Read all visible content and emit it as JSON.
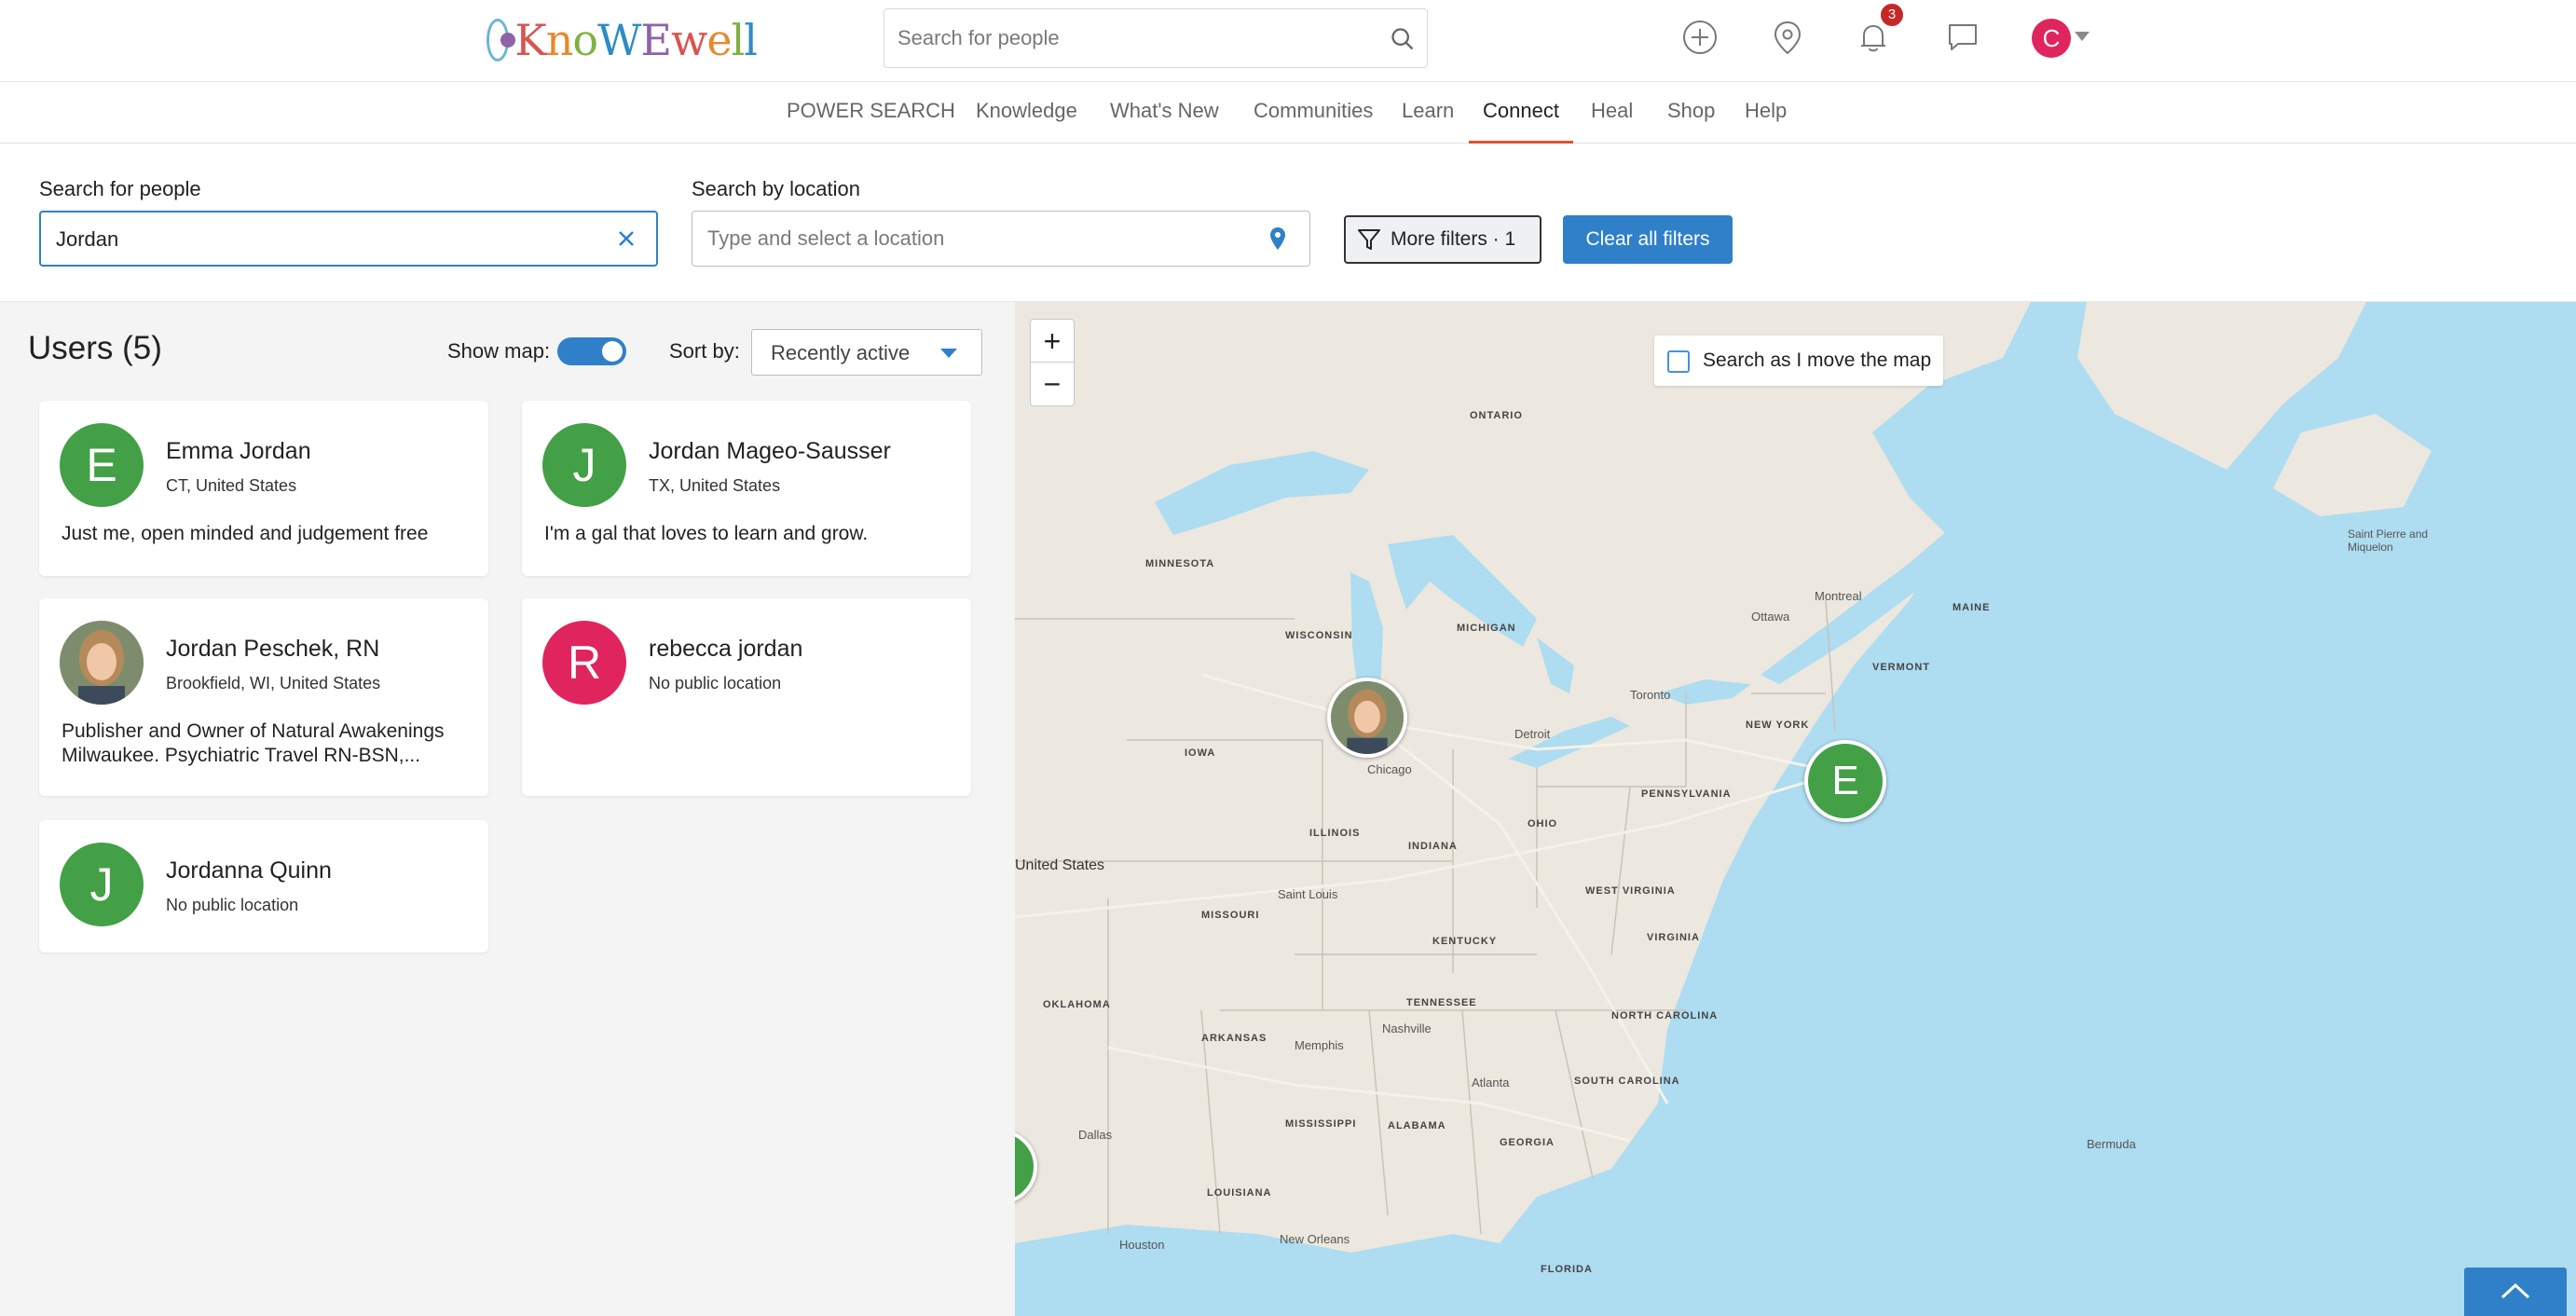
{
  "header": {
    "logo_text": "KnoWEwell",
    "search_placeholder": "Search for people",
    "notification_count": "3",
    "user_initial": "C"
  },
  "nav": {
    "items": [
      {
        "label": "POWER SEARCH"
      },
      {
        "label": "Knowledge"
      },
      {
        "label": "What's New"
      },
      {
        "label": "Communities"
      },
      {
        "label": "Learn"
      },
      {
        "label": "Connect",
        "active": true
      },
      {
        "label": "Heal"
      },
      {
        "label": "Shop"
      },
      {
        "label": "Help"
      }
    ]
  },
  "filters": {
    "people_label": "Search for people",
    "people_value": "Jordan",
    "location_label": "Search by location",
    "location_placeholder": "Type and select a location",
    "more_filters_label": "More filters · 1",
    "clear_label": "Clear all filters"
  },
  "results": {
    "title": "Users (5)",
    "show_map_label": "Show map:",
    "show_map_on": true,
    "sort_label": "Sort by:",
    "sort_value": "Recently active",
    "users": [
      {
        "initial": "E",
        "name": "Emma Jordan",
        "location": "CT, United States",
        "bio": "Just me, open minded and judgement free",
        "avatar_color": "#43a047"
      },
      {
        "initial": "J",
        "name": "Jordan Mageo-Sausser",
        "location": "TX, United States",
        "bio": "I'm a gal that loves to learn and grow.",
        "avatar_color": "#43a047"
      },
      {
        "initial": "",
        "name": "Jordan Peschek, RN",
        "location": "Brookfield, WI, United States",
        "bio": "Publisher and Owner of Natural Awakenings Milwaukee. Psychiatric Travel RN-BSN,...",
        "avatar_color": "#9c8572"
      },
      {
        "initial": "R",
        "name": "rebecca jordan",
        "location": "No public location",
        "bio": "",
        "avatar_color": "#e0245e"
      },
      {
        "initial": "J",
        "name": "Jordanna Quinn",
        "location": "No public location",
        "bio": "",
        "avatar_color": "#43a047"
      }
    ]
  },
  "map": {
    "zoom_in": "+",
    "zoom_out": "−",
    "search_move_label": "Search as I move the map",
    "marker_e_initial": "E",
    "labels": {
      "ontario": "ONTARIO",
      "minnesota": "MINNESOTA",
      "wisconsin": "WISCONSIN",
      "michigan": "MICHIGAN",
      "iowa": "IOWA",
      "illinois": "ILLINOIS",
      "indiana": "INDIANA",
      "ohio": "OHIO",
      "pennsylvania": "PENNSYLVANIA",
      "new_york": "NEW YORK",
      "missouri": "MISSOURI",
      "kentucky": "KENTUCKY",
      "west_virginia": "WEST VIRGINIA",
      "virginia": "VIRGINIA",
      "tennessee": "TENNESSEE",
      "north_carolina": "NORTH CAROLINA",
      "south_carolina": "SOUTH CAROLINA",
      "arkansas": "ARKANSAS",
      "oklahoma": "OKLAHOMA",
      "mississippi": "MISSISSIPPI",
      "alabama": "ALABAMA",
      "georgia": "GEORGIA",
      "louisiana": "LOUISIANA",
      "florida": "FLORIDA",
      "maine": "MAINE",
      "vermont": "VERMONT",
      "united_states": "United States",
      "chicago": "Chicago",
      "detroit": "Detroit",
      "toronto": "Toronto",
      "montreal": "Montreal",
      "ottawa": "Ottawa",
      "atlanta": "Atlanta",
      "dallas": "Dallas",
      "houston": "Houston",
      "memphis": "Memphis",
      "nashville": "Nashville",
      "st_louis": "Saint Louis",
      "new_orleans": "New Orleans",
      "bermuda": "Bermuda",
      "saint_pierre": "Saint Pierre and Miquelon"
    }
  },
  "colors": {
    "accent": "#2f80c9",
    "nav_active_underline": "#e2512d",
    "avatar_green": "#43a047",
    "avatar_pink": "#e0245e",
    "badge_red": "#c62828",
    "water": "#aedcf0",
    "land": "#ece8df"
  }
}
